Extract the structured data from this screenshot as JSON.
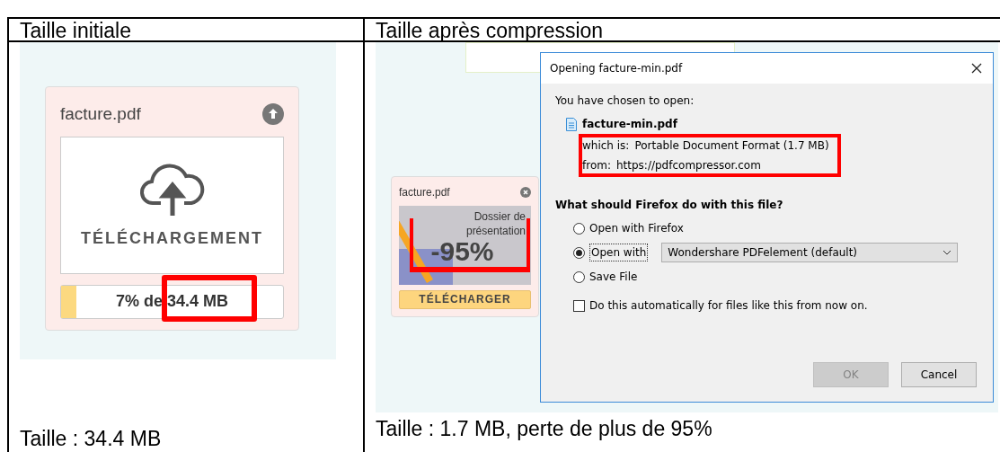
{
  "table": {
    "headers": [
      "Taille initiale",
      "Taille après compression"
    ],
    "left": {
      "upload_card": {
        "file_name": "facture.pdf",
        "label": "TÉLÉCHARGEMENT",
        "progress": {
          "level": 0.07,
          "text": "7% de 34.4 MB"
        }
      },
      "caption": "Taille : 34.4 MB"
    },
    "right": {
      "file_card": {
        "file_name": "facture.pdf",
        "thumbnail_lines": [
          "Dossier de",
          "présentation"
        ],
        "badge": "-95%",
        "button": "TÉLÉCHARGER"
      },
      "dialog": {
        "title": "Opening facture-min.pdf",
        "intro": "You have chosen to open:",
        "file_name": "facture-min.pdf",
        "details": [
          {
            "label": "which is:",
            "value": "Portable Document Format (1.7 MB)"
          },
          {
            "label": "from:",
            "value": "https://pdfcompressor.com"
          }
        ],
        "question": "What should Firefox do with this file?",
        "options": [
          {
            "kind": "radio",
            "label": "Open with Firefox",
            "selected": false
          },
          {
            "kind": "radio-select",
            "label": "Open with",
            "selected": true,
            "value": "Wondershare PDFelement (default)"
          },
          {
            "kind": "radio",
            "label": "Save File",
            "selected": false
          }
        ],
        "auto": {
          "label": "Do this automatically for files like this from now on.",
          "checked": false
        },
        "buttons": [
          {
            "label": "OK",
            "disabled": true
          },
          {
            "label": "Cancel",
            "disabled": false
          }
        ]
      },
      "caption": "Taille : 1.7 MB, perte de plus de 95%"
    }
  }
}
